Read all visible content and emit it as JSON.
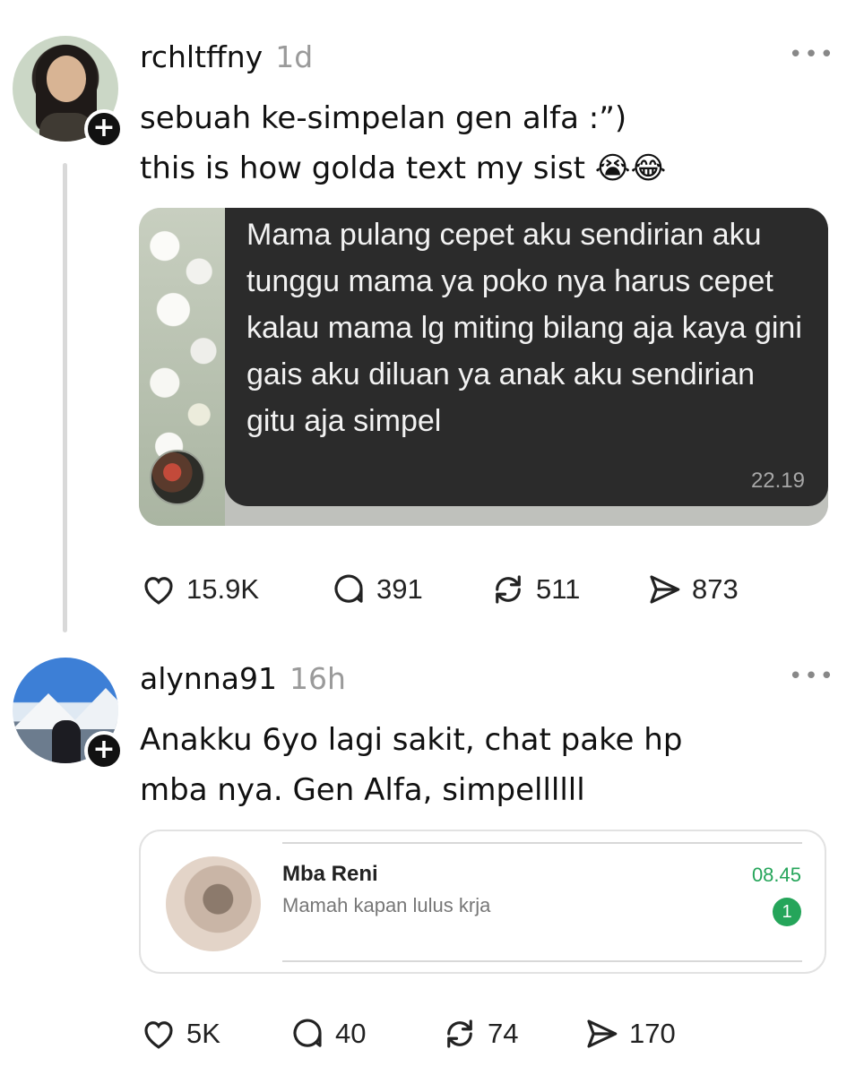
{
  "posts": [
    {
      "username": "rchltffny",
      "time": "1d",
      "text_lines": [
        "sebuah ke-simpelan gen alfa :”)",
        "this is how golda text my sist 😭😂"
      ],
      "media": {
        "message_text": "Mama pulang cepet aku sendirian aku tunggu mama ya poko nya harus cepet kalau mama lg miting bilang aja kaya gini gais aku diluan ya anak aku sendirian gitu aja simpel",
        "message_time": "22.19"
      },
      "actions": {
        "likes": "15.9K",
        "replies": "391",
        "reposts": "511",
        "shares": "873"
      },
      "more": "•••"
    },
    {
      "username": "alynna91",
      "time": "16h",
      "text_lines": [
        "Anakku 6yo lagi sakit, chat pake hp",
        "mba nya. Gen Alfa, simpellllll"
      ],
      "media": {
        "contact_name": "Mba Reni",
        "last_message": "Mamah kapan lulus krja",
        "chat_time": "08.45",
        "unread_count": "1"
      },
      "actions": {
        "likes": "5K",
        "replies": "40",
        "reposts": "74",
        "shares": "170"
      },
      "more": "•••"
    }
  ],
  "follow_symbol": "+",
  "colors": {
    "accent_green": "#25a55a",
    "bubble_dark": "#2b2b2b",
    "muted": "#9a9a9a"
  }
}
